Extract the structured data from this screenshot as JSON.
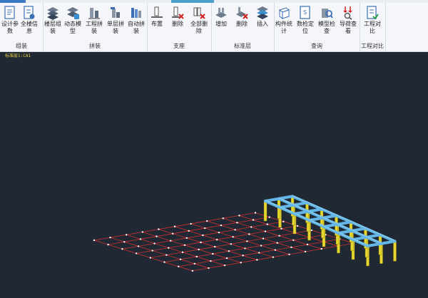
{
  "ribbon": {
    "groups": [
      {
        "label": "组装",
        "buttons": [
          {
            "label": "设计参数",
            "icon": "design-params-icon"
          },
          {
            "label": "全楼信息",
            "icon": "building-info-icon"
          }
        ]
      },
      {
        "label": "拼装",
        "buttons": [
          {
            "label": "楼层组装",
            "icon": "floor-assembly-icon"
          },
          {
            "label": "动态模型",
            "icon": "dynamic-model-icon"
          },
          {
            "label": "工程拼装",
            "icon": "project-splice-icon"
          },
          {
            "label": "单层拼装",
            "icon": "single-floor-splice-icon"
          },
          {
            "label": "自动拼装",
            "icon": "auto-splice-icon"
          }
        ]
      },
      {
        "label": "支座",
        "buttons": [
          {
            "label": "布置",
            "icon": "support-place-icon"
          },
          {
            "label": "删除",
            "icon": "support-delete-icon"
          },
          {
            "label": "全部删除",
            "icon": "support-delete-all-icon"
          }
        ]
      },
      {
        "label": "标准层",
        "buttons": [
          {
            "label": "增加",
            "icon": "std-floor-add-icon"
          },
          {
            "label": "删除",
            "icon": "std-floor-delete-icon"
          },
          {
            "label": "插入",
            "icon": "std-floor-insert-icon"
          }
        ]
      },
      {
        "label": "查询",
        "buttons": [
          {
            "label": "构件统计",
            "icon": "member-stats-icon"
          },
          {
            "label": "数检定位",
            "icon": "data-check-icon"
          },
          {
            "label": "模型检查",
            "icon": "model-check-icon"
          },
          {
            "label": "导荷查看",
            "icon": "load-transfer-icon"
          }
        ]
      },
      {
        "label": "工程对比",
        "buttons": [
          {
            "label": "工程对比",
            "icon": "project-compare-icon"
          }
        ]
      }
    ]
  },
  "viewport": {
    "floor_label": "标准层1:CA1",
    "colors": {
      "background": "#202833",
      "grid": "#d23030",
      "beam": "#63b6e6",
      "column": "#e6d630",
      "node": "#ffffff"
    }
  }
}
